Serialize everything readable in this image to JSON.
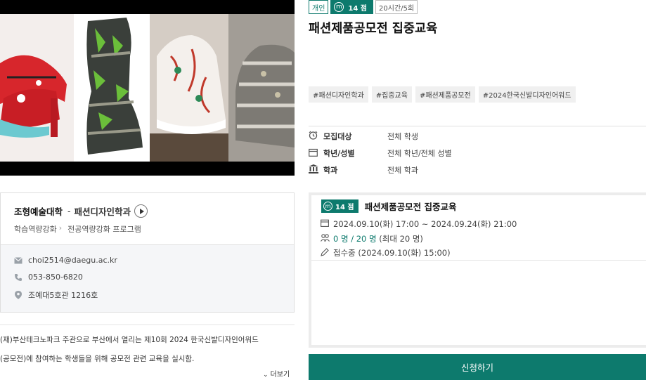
{
  "dept_card": {
    "college": "조형예술대학",
    "separator": "-",
    "department": "패션디자인학과",
    "crumb_1": "학습역량강화",
    "crumb_2": "전공역량강화 프로그램"
  },
  "contact": {
    "email": "choi2514@daegu.ac.kr",
    "phone": "053-850-6820",
    "location": "조예대5호관 1216호"
  },
  "description": {
    "line_1": "(재)부산테크노파크 주관으로 부산에서 열리는 제10회 2024 한국신발디자인어워드",
    "line_2": "(공모전)에 참여하는 학생들을 위해 공모전 관련 교육을 실시함.",
    "more_label": "더보기"
  },
  "badges": {
    "type": "개인",
    "mileage_icon": "m",
    "points": "14 점",
    "hours": "20시간/5회"
  },
  "title": "패션제품공모전 집중교육",
  "tags": [
    "#패션디자인학과",
    "#집중교육",
    "#패션제품공모전",
    "#2024한국신발디자인어워드"
  ],
  "info": {
    "target_label": "모집대상",
    "target_value": "전체 학생",
    "grade_label": "학년/성별",
    "grade_value": "전체 학년/전체 성별",
    "dept_label": "학과",
    "dept_value": "전체 학과"
  },
  "session": {
    "mileage_icon": "m",
    "points": "14 점",
    "title": "패션제품공모전 집중교육",
    "period": "2024.09.10(화) 17:00 ~ 2024.09.24(화) 21:00",
    "capacity_current": "0 명 / 20 명",
    "capacity_max": "(최대 20 명)",
    "status": "접수중 (2024.09.10(화) 15:00)"
  },
  "apply_label": "신청하기",
  "colors": {
    "accent": "#0d7a6d",
    "tag_bg": "#f0f0f0",
    "contact_bg": "#f5f6f8"
  },
  "icons": {
    "email": "envelope-icon",
    "phone": "phone-icon",
    "location": "map-pin-icon",
    "target": "alarm-clock-icon",
    "grade": "calendar-icon",
    "dept": "building-icon",
    "period": "calendar-icon",
    "capacity": "people-icon",
    "status": "pen-icon"
  }
}
